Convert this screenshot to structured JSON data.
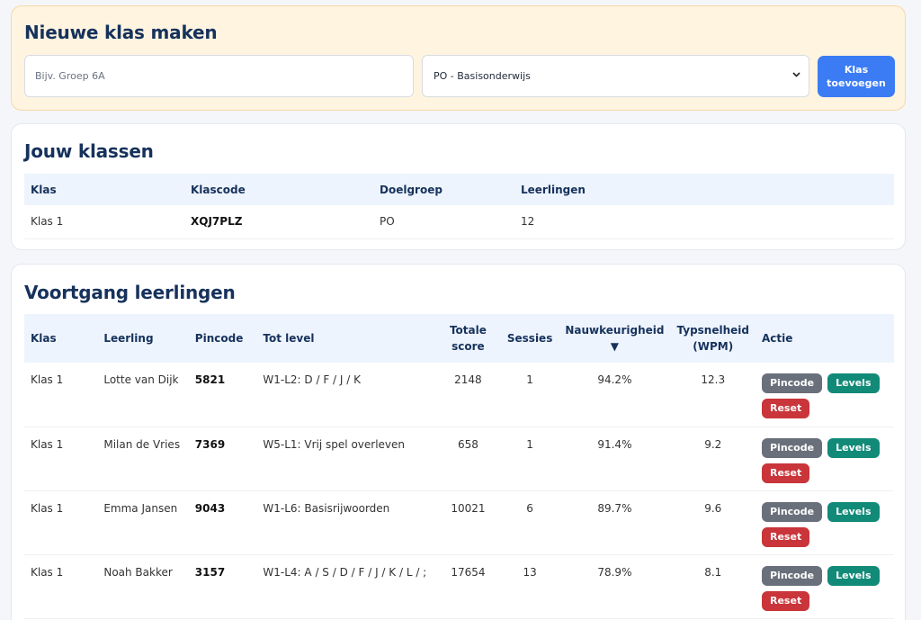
{
  "create": {
    "title": "Nieuwe klas maken",
    "name_placeholder": "Bijv. Groep 6A",
    "name_value": "",
    "target_select": "PO - Basisonderwijs",
    "add_button": "Klas toevoegen"
  },
  "classes": {
    "title": "Jouw klassen",
    "headers": [
      "Klas",
      "Klascode",
      "Doelgroep",
      "Leerlingen"
    ],
    "rows": [
      {
        "klas": "Klas 1",
        "code": "XQJ7PLZ",
        "doelgroep": "PO",
        "leerlingen": "12"
      }
    ]
  },
  "progress": {
    "title": "Voortgang leerlingen",
    "headers": {
      "klas": "Klas",
      "leerling": "Leerling",
      "pincode": "Pincode",
      "level": "Tot level",
      "score": "Totale score",
      "sessies": "Sessies",
      "nauwkeurigheid": "Nauwkeurigheid ▼",
      "wpm": "Typsnelheid (WPM)",
      "actie": "Actie"
    },
    "action_labels": {
      "pincode": "Pincode",
      "levels": "Levels",
      "reset": "Reset"
    },
    "rows": [
      {
        "klas": "Klas 1",
        "leerling": "Lotte van Dijk",
        "pincode": "5821",
        "level": "W1-L2: D / F / J / K",
        "score": "2148",
        "sessies": "1",
        "nauwkeurigheid": "94.2%",
        "wpm": "12.3"
      },
      {
        "klas": "Klas 1",
        "leerling": "Milan de Vries",
        "pincode": "7369",
        "level": "W5-L1: Vrij spel overleven",
        "score": "658",
        "sessies": "1",
        "nauwkeurigheid": "91.4%",
        "wpm": "9.2"
      },
      {
        "klas": "Klas 1",
        "leerling": "Emma Jansen",
        "pincode": "9043",
        "level": "W1-L6: Basisrijwoorden",
        "score": "10021",
        "sessies": "6",
        "nauwkeurigheid": "89.7%",
        "wpm": "9.6"
      },
      {
        "klas": "Klas 1",
        "leerling": "Noah Bakker",
        "pincode": "3157",
        "level": "W1-L4: A / S / D / F / J / K / L / ;",
        "score": "17654",
        "sessies": "13",
        "nauwkeurigheid": "78.9%",
        "wpm": "8.1"
      }
    ]
  }
}
